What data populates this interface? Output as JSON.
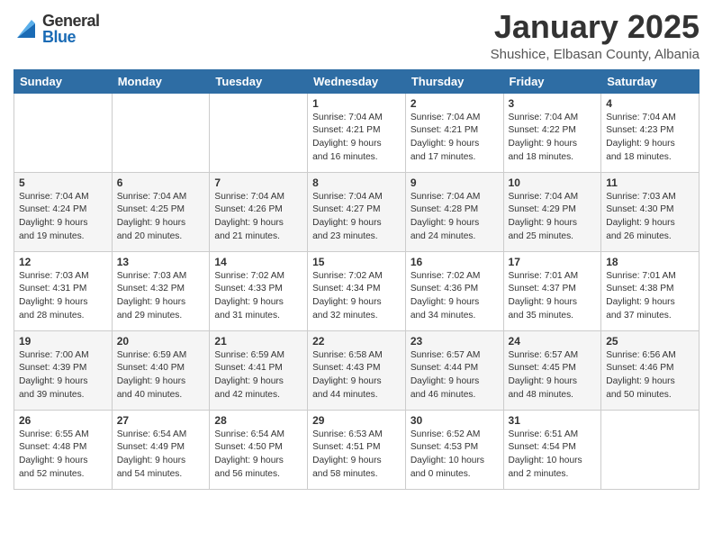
{
  "header": {
    "logo_general": "General",
    "logo_blue": "Blue",
    "month_title": "January 2025",
    "subtitle": "Shushice, Elbasan County, Albania"
  },
  "days_of_week": [
    "Sunday",
    "Monday",
    "Tuesday",
    "Wednesday",
    "Thursday",
    "Friday",
    "Saturday"
  ],
  "weeks": [
    {
      "days": [
        {
          "num": "",
          "info": ""
        },
        {
          "num": "",
          "info": ""
        },
        {
          "num": "",
          "info": ""
        },
        {
          "num": "1",
          "info": "Sunrise: 7:04 AM\nSunset: 4:21 PM\nDaylight: 9 hours\nand 16 minutes."
        },
        {
          "num": "2",
          "info": "Sunrise: 7:04 AM\nSunset: 4:21 PM\nDaylight: 9 hours\nand 17 minutes."
        },
        {
          "num": "3",
          "info": "Sunrise: 7:04 AM\nSunset: 4:22 PM\nDaylight: 9 hours\nand 18 minutes."
        },
        {
          "num": "4",
          "info": "Sunrise: 7:04 AM\nSunset: 4:23 PM\nDaylight: 9 hours\nand 18 minutes."
        }
      ]
    },
    {
      "days": [
        {
          "num": "5",
          "info": "Sunrise: 7:04 AM\nSunset: 4:24 PM\nDaylight: 9 hours\nand 19 minutes."
        },
        {
          "num": "6",
          "info": "Sunrise: 7:04 AM\nSunset: 4:25 PM\nDaylight: 9 hours\nand 20 minutes."
        },
        {
          "num": "7",
          "info": "Sunrise: 7:04 AM\nSunset: 4:26 PM\nDaylight: 9 hours\nand 21 minutes."
        },
        {
          "num": "8",
          "info": "Sunrise: 7:04 AM\nSunset: 4:27 PM\nDaylight: 9 hours\nand 23 minutes."
        },
        {
          "num": "9",
          "info": "Sunrise: 7:04 AM\nSunset: 4:28 PM\nDaylight: 9 hours\nand 24 minutes."
        },
        {
          "num": "10",
          "info": "Sunrise: 7:04 AM\nSunset: 4:29 PM\nDaylight: 9 hours\nand 25 minutes."
        },
        {
          "num": "11",
          "info": "Sunrise: 7:03 AM\nSunset: 4:30 PM\nDaylight: 9 hours\nand 26 minutes."
        }
      ]
    },
    {
      "days": [
        {
          "num": "12",
          "info": "Sunrise: 7:03 AM\nSunset: 4:31 PM\nDaylight: 9 hours\nand 28 minutes."
        },
        {
          "num": "13",
          "info": "Sunrise: 7:03 AM\nSunset: 4:32 PM\nDaylight: 9 hours\nand 29 minutes."
        },
        {
          "num": "14",
          "info": "Sunrise: 7:02 AM\nSunset: 4:33 PM\nDaylight: 9 hours\nand 31 minutes."
        },
        {
          "num": "15",
          "info": "Sunrise: 7:02 AM\nSunset: 4:34 PM\nDaylight: 9 hours\nand 32 minutes."
        },
        {
          "num": "16",
          "info": "Sunrise: 7:02 AM\nSunset: 4:36 PM\nDaylight: 9 hours\nand 34 minutes."
        },
        {
          "num": "17",
          "info": "Sunrise: 7:01 AM\nSunset: 4:37 PM\nDaylight: 9 hours\nand 35 minutes."
        },
        {
          "num": "18",
          "info": "Sunrise: 7:01 AM\nSunset: 4:38 PM\nDaylight: 9 hours\nand 37 minutes."
        }
      ]
    },
    {
      "days": [
        {
          "num": "19",
          "info": "Sunrise: 7:00 AM\nSunset: 4:39 PM\nDaylight: 9 hours\nand 39 minutes."
        },
        {
          "num": "20",
          "info": "Sunrise: 6:59 AM\nSunset: 4:40 PM\nDaylight: 9 hours\nand 40 minutes."
        },
        {
          "num": "21",
          "info": "Sunrise: 6:59 AM\nSunset: 4:41 PM\nDaylight: 9 hours\nand 42 minutes."
        },
        {
          "num": "22",
          "info": "Sunrise: 6:58 AM\nSunset: 4:43 PM\nDaylight: 9 hours\nand 44 minutes."
        },
        {
          "num": "23",
          "info": "Sunrise: 6:57 AM\nSunset: 4:44 PM\nDaylight: 9 hours\nand 46 minutes."
        },
        {
          "num": "24",
          "info": "Sunrise: 6:57 AM\nSunset: 4:45 PM\nDaylight: 9 hours\nand 48 minutes."
        },
        {
          "num": "25",
          "info": "Sunrise: 6:56 AM\nSunset: 4:46 PM\nDaylight: 9 hours\nand 50 minutes."
        }
      ]
    },
    {
      "days": [
        {
          "num": "26",
          "info": "Sunrise: 6:55 AM\nSunset: 4:48 PM\nDaylight: 9 hours\nand 52 minutes."
        },
        {
          "num": "27",
          "info": "Sunrise: 6:54 AM\nSunset: 4:49 PM\nDaylight: 9 hours\nand 54 minutes."
        },
        {
          "num": "28",
          "info": "Sunrise: 6:54 AM\nSunset: 4:50 PM\nDaylight: 9 hours\nand 56 minutes."
        },
        {
          "num": "29",
          "info": "Sunrise: 6:53 AM\nSunset: 4:51 PM\nDaylight: 9 hours\nand 58 minutes."
        },
        {
          "num": "30",
          "info": "Sunrise: 6:52 AM\nSunset: 4:53 PM\nDaylight: 10 hours\nand 0 minutes."
        },
        {
          "num": "31",
          "info": "Sunrise: 6:51 AM\nSunset: 4:54 PM\nDaylight: 10 hours\nand 2 minutes."
        },
        {
          "num": "",
          "info": ""
        }
      ]
    }
  ]
}
